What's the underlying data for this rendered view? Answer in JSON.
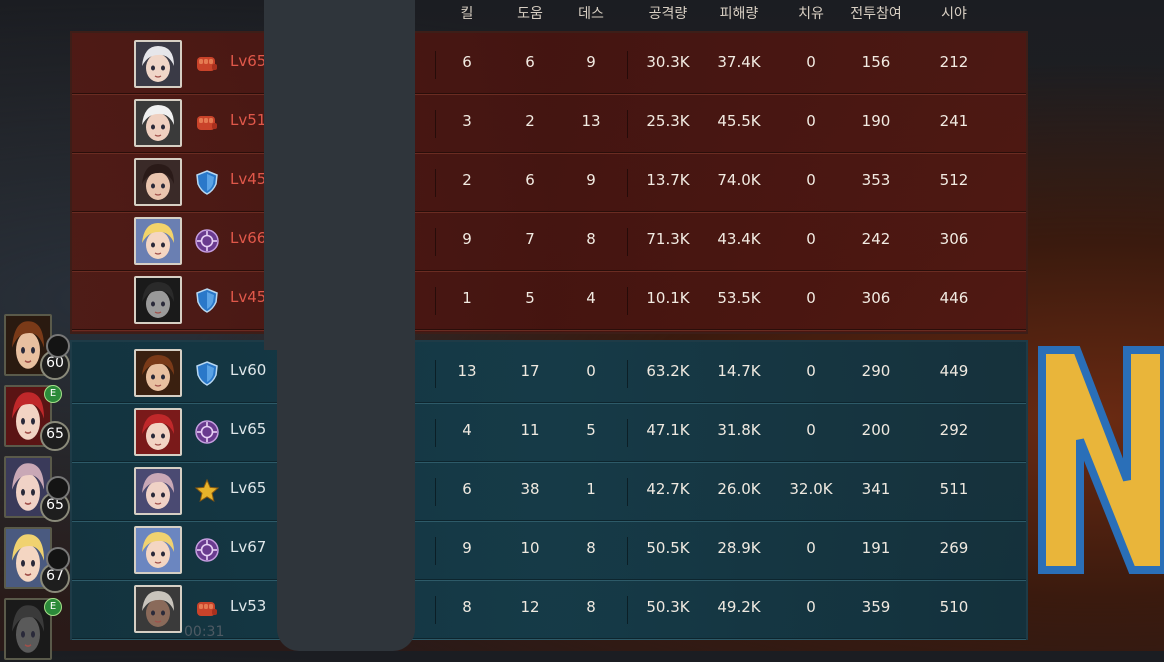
{
  "columns": [
    "킬",
    "도움",
    "데스",
    "공격량",
    "피해량",
    "치유",
    "전투참여",
    "시야"
  ],
  "teams": {
    "red": [
      {
        "level": "Lv65",
        "role": "fist-icon",
        "kills": "6",
        "assists": "6",
        "deaths": "9",
        "attack": "30.3K",
        "damage": "37.4K",
        "heal": "0",
        "participation": "156",
        "vision": "212"
      },
      {
        "level": "Lv51",
        "role": "fist-icon",
        "kills": "3",
        "assists": "2",
        "deaths": "13",
        "attack": "25.3K",
        "damage": "45.5K",
        "heal": "0",
        "participation": "190",
        "vision": "241"
      },
      {
        "level": "Lv45",
        "role": "shield-icon",
        "kills": "2",
        "assists": "6",
        "deaths": "9",
        "attack": "13.7K",
        "damage": "74.0K",
        "heal": "0",
        "participation": "353",
        "vision": "512"
      },
      {
        "level": "Lv66",
        "role": "crosshair-icon",
        "kills": "9",
        "assists": "7",
        "deaths": "8",
        "attack": "71.3K",
        "damage": "43.4K",
        "heal": "0",
        "participation": "242",
        "vision": "306"
      },
      {
        "level": "Lv45",
        "role": "shield-icon",
        "kills": "1",
        "assists": "5",
        "deaths": "4",
        "attack": "10.1K",
        "damage": "53.5K",
        "heal": "0",
        "participation": "306",
        "vision": "446"
      }
    ],
    "blue": [
      {
        "level": "Lv60",
        "role": "shield-icon",
        "kills": "13",
        "assists": "17",
        "deaths": "0",
        "attack": "63.2K",
        "damage": "14.7K",
        "heal": "0",
        "participation": "290",
        "vision": "449"
      },
      {
        "level": "Lv65",
        "role": "crosshair-icon",
        "kills": "4",
        "assists": "11",
        "deaths": "5",
        "attack": "47.1K",
        "damage": "31.8K",
        "heal": "0",
        "participation": "200",
        "vision": "292"
      },
      {
        "level": "Lv65",
        "role": "star-icon",
        "kills": "6",
        "assists": "38",
        "deaths": "1",
        "attack": "42.7K",
        "damage": "26.0K",
        "heal": "32.0K",
        "participation": "341",
        "vision": "511"
      },
      {
        "level": "Lv67",
        "role": "crosshair-icon",
        "kills": "9",
        "assists": "10",
        "deaths": "8",
        "attack": "50.5K",
        "damage": "28.9K",
        "heal": "0",
        "participation": "191",
        "vision": "269"
      },
      {
        "level": "Lv53",
        "role": "fist-icon",
        "kills": "8",
        "assists": "12",
        "deaths": "8",
        "attack": "50.3K",
        "damage": "49.2K",
        "heal": "0",
        "participation": "359",
        "vision": "510"
      }
    ]
  },
  "side_party": [
    {
      "level": "60",
      "badge": ""
    },
    {
      "level": "65",
      "badge": "E"
    },
    {
      "level": "65",
      "badge": ""
    },
    {
      "level": "67",
      "badge": ""
    },
    {
      "level": "",
      "badge": "E"
    }
  ],
  "timer": "00:31"
}
